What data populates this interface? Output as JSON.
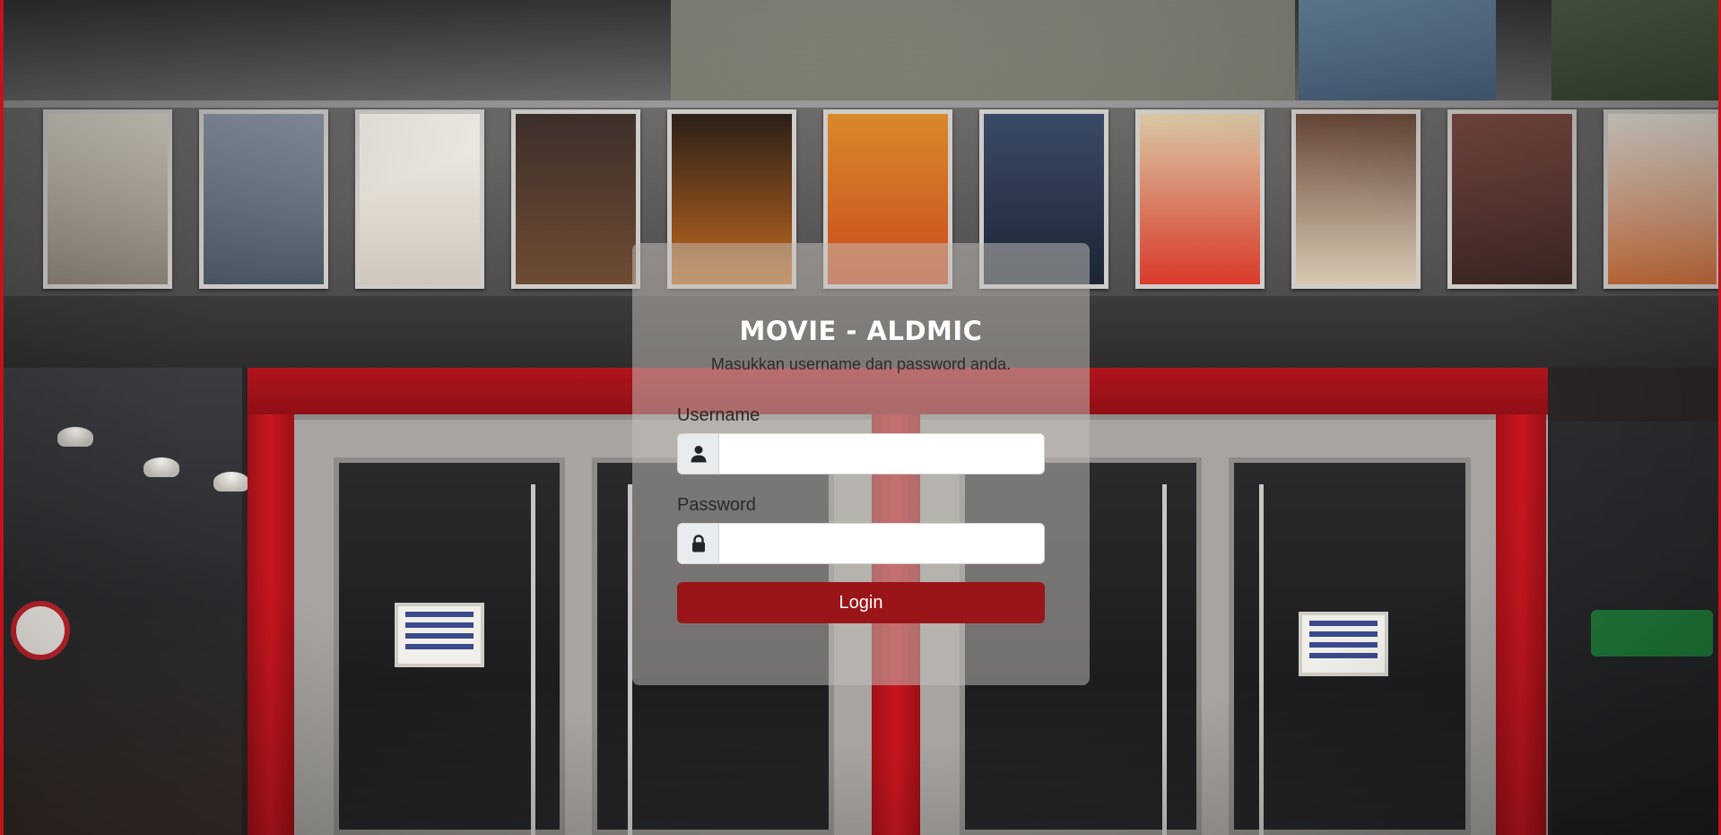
{
  "app": {
    "title": "MOVIE - ALDMIC",
    "subtitle": "Masukkan username dan password anda."
  },
  "form": {
    "username": {
      "label": "Username",
      "value": "",
      "placeholder": "",
      "icon": "user-icon"
    },
    "password": {
      "label": "Password",
      "value": "",
      "placeholder": "",
      "icon": "lock-icon"
    },
    "submit_label": "Login"
  },
  "background": {
    "description_colors": {
      "accent_red": "#9a1518",
      "facade_red": "#b0141c",
      "card_overlay": "rgba(196,192,186,0.52)"
    }
  }
}
